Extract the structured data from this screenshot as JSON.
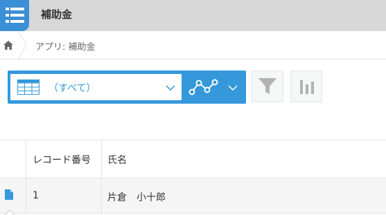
{
  "header": {
    "app_title": "補助金",
    "app_icon": "list-icon",
    "accent": "#3b8fd6"
  },
  "breadcrumb": {
    "home_icon": "home-icon",
    "text": "アプリ: 補助金"
  },
  "toolbar": {
    "view_select_value": "（すべて）",
    "view_icon": "table-view-icon",
    "graph_icon": "line-graph-icon",
    "filter_icon": "filter-icon",
    "chart_icon": "bar-chart-icon",
    "accent": "#3498db"
  },
  "table": {
    "columns": [
      "レコード番号",
      "氏名"
    ],
    "rows": [
      {
        "record_number": "1",
        "name": "片倉　小十郎"
      }
    ]
  }
}
